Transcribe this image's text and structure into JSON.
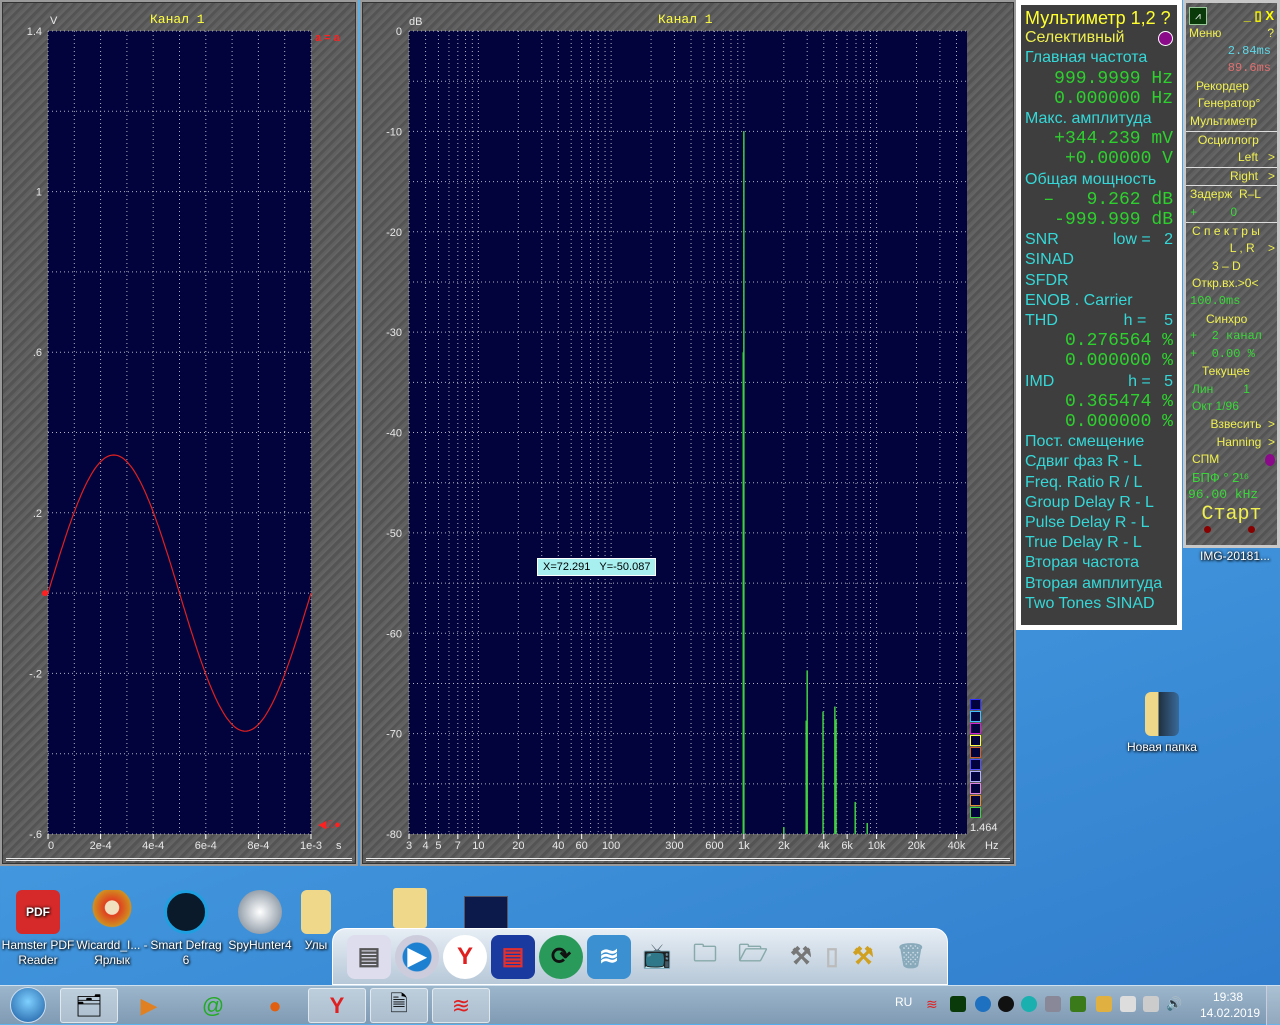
{
  "scope": {
    "title": "Канал 1",
    "y_unit": "V",
    "x_unit": "s",
    "marker_top": "a = a",
    "marker_bottom": "◀⎍●",
    "chart_data": {
      "type": "line",
      "title": "Канал 1",
      "ylabel": "V",
      "xlabel": "s",
      "xlim": [
        0,
        0.001
      ],
      "ylim": [
        -0.6,
        1.4
      ],
      "grid": true,
      "x_ticks": [
        "0",
        "2e-4",
        "4e-4",
        "6e-4",
        "8e-4",
        "1e-3"
      ],
      "y_ticks": [
        "1.4",
        "1",
        ".6",
        ".2",
        "-.2",
        "-.6"
      ],
      "series": [
        {
          "signal": "sine",
          "amplitude_V": 0.344,
          "frequency_Hz": 1000,
          "color": "#e02020"
        }
      ]
    }
  },
  "spectrum": {
    "title": "Канал 1",
    "y_unit": "dB",
    "x_unit": "Hz",
    "scale_value": "1.464",
    "cursor_readout": "X=72.291   Y=-50.087",
    "legend_colors": [
      "#3030ff",
      "#40c0ff",
      "#d020d0",
      "#ffff40",
      "#d06030",
      "#5050ff",
      "#b0b0ff",
      "#e080e0",
      "#e09030",
      "#40d040"
    ],
    "chart_data": {
      "type": "bar",
      "title": "Канал 1",
      "ylabel": "dB",
      "xlabel": "Hz",
      "x_scale": "log",
      "xlim": [
        3,
        48000
      ],
      "ylim": [
        -80,
        0
      ],
      "grid": true,
      "x_ticks": [
        "3",
        "4",
        "5",
        "7",
        "10",
        "20",
        "40",
        "60",
        "100",
        "300",
        "600",
        "1k",
        "2k",
        "4k",
        "6k",
        "10k",
        "20k",
        "40k"
      ],
      "y_ticks": [
        "0",
        "-10",
        "-20",
        "-30",
        "-40",
        "-50",
        "-60",
        "-70",
        "-80"
      ],
      "peaks": [
        {
          "f": 1000,
          "db": -10.0
        },
        {
          "f": 990,
          "db": -32
        },
        {
          "f": 2000,
          "db": -79.3
        },
        {
          "f": 2950,
          "db": -68.7
        },
        {
          "f": 3000,
          "db": -63.7
        },
        {
          "f": 3950,
          "db": -67.8
        },
        {
          "f": 4850,
          "db": -67.3
        },
        {
          "f": 4950,
          "db": -68.6
        },
        {
          "f": 6900,
          "db": -76.8
        },
        {
          "f": 8500,
          "db": -78.9
        }
      ],
      "color": "#40d040"
    }
  },
  "multimeter": {
    "title": "Мультиметр 1,2 ?",
    "selective": "Селективный",
    "main_freq": "Главная частота",
    "f1": "999.9999 Hz",
    "f2": "0.000000 Hz",
    "max_amp": "Макс. амплитуда",
    "a1": "+344.239 mV",
    "a2": "+0.00000  V",
    "power": "Общая мощность",
    "p1": "–   9.262 dB",
    "p2": "-999.999 dB",
    "snr": "SNR",
    "snr_low": "low =   2",
    "sinad": "SINAD",
    "sfdr": "SFDR",
    "enob": "ENOB . Carrier",
    "thd": "THD",
    "thd_h": "h =    5",
    "thd1": "0.276564 %",
    "thd2": "0.000000 %",
    "imd": "IMD",
    "imd_h": "h =   5",
    "imd1": "0.365474 %",
    "imd2": "0.000000 %",
    "rest": [
      "Пост. смещение",
      "Сдвиг фаз R - L",
      "Freq. Ratio  R / L",
      "Group Delay R - L",
      "Pulse Delay R - L",
      "True Delay R - L",
      "Вторая частота",
      "Вторая амплитуда",
      "Two Tones SINAD"
    ]
  },
  "control": {
    "min_max": "_ ▯ X",
    "menu": "Меню",
    "help": "?",
    "t1": "2.84ms",
    "t2": "89.6ms",
    "recorder": "Рекордер",
    "generator": "Генератор°",
    "multimeter": "Мультиметр",
    "scope": "Осциллогр",
    "left": "Left   >",
    "right": "Right   >",
    "delay": "Задерж  R–L",
    "delay_val": "+          0",
    "spectra": "С п е к т р ы",
    "lr": "L , R    >",
    "threed": "3 – D",
    "open_in": "Откр.вх.>0<",
    "ms100": "100.0ms",
    "sync": "Синхро",
    "sync_ch": "+  2 канал",
    "sync_pct": "+  0.00 %",
    "current": "Текущее",
    "lin": "Лин         1",
    "oct": "Окт  1/96",
    "weigh": "Взвесить  >",
    "hanning": "Hanning  >",
    "spm": "СПМ",
    "fft": "БПФ ° 2¹⁶",
    "rate": "96.00 kHz",
    "start": "Старт"
  },
  "desktop": {
    "icons": [
      "Hamster PDF Reader",
      "Wicardd_I... - Ярлык",
      "Smart Defrag 6",
      "SpyHunter4",
      "Улы"
    ],
    "img_label": "IMG-20181...",
    "folder": "Новая папка"
  },
  "taskbar": {
    "lang": "RU",
    "time": "19:38",
    "date": "14.02.2019"
  }
}
